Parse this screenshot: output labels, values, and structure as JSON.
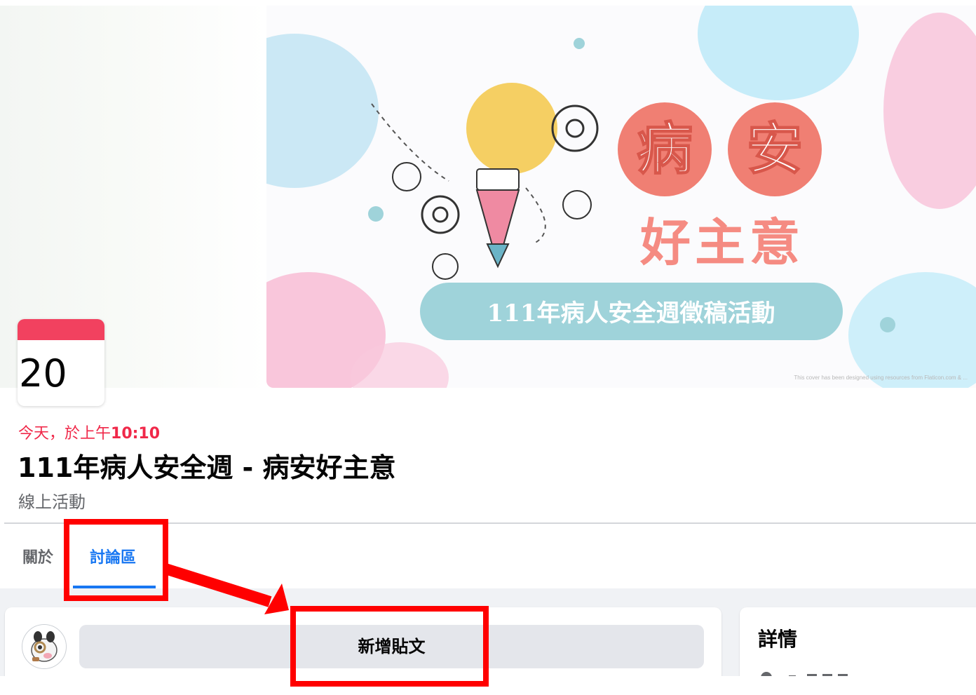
{
  "cover": {
    "badge_chars": [
      "病",
      "安"
    ],
    "subtitle": "好主意",
    "banner_text": "111年病人安全週徵稿活動",
    "credit": "This cover has been designed using resources from Flaticon.com & ..."
  },
  "event": {
    "date_day": "20",
    "time_prefix": "今天，於上午",
    "time_value": "10:10",
    "title": "111年病人安全週 - 病安好主意",
    "type": "線上活動"
  },
  "tabs": {
    "items": [
      {
        "label": "關於",
        "active": false
      },
      {
        "label": "討論區",
        "active": true
      }
    ]
  },
  "composer": {
    "post_button_label": "新增貼文"
  },
  "details": {
    "title": "詳情"
  },
  "colors": {
    "accent_blue": "#1877f2",
    "date_red": "#f02849",
    "annotation_red": "#ff0000",
    "badge_coral": "#f07f73",
    "banner_teal": "#9fd3da"
  }
}
